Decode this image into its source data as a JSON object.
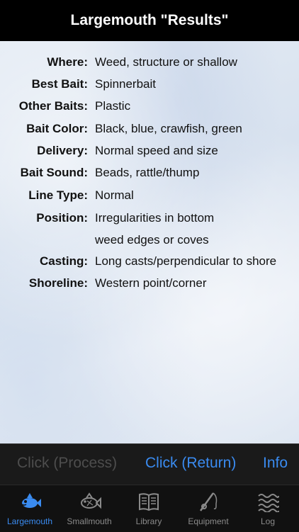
{
  "nav": {
    "title": "Largemouth \"Results\""
  },
  "results": [
    {
      "label": "Where:",
      "value": "Weed, structure or shallow"
    },
    {
      "label": "Best Bait:",
      "value": "Spinnerbait"
    },
    {
      "label": "Other Baits:",
      "value": "Plastic"
    },
    {
      "label": "Bait Color:",
      "value": "Black, blue, crawfish, green"
    },
    {
      "label": "Delivery:",
      "value": "Normal speed and size"
    },
    {
      "label": "Bait Sound:",
      "value": "Beads, rattle/thump"
    },
    {
      "label": "Line Type:",
      "value": "Normal"
    },
    {
      "label": "Position:",
      "value": "Irregularities in bottom",
      "value2": "weed edges or coves"
    },
    {
      "label": "Casting:",
      "value": "Long casts/perpendicular to shore"
    },
    {
      "label": "Shoreline:",
      "value": "Western point/corner"
    }
  ],
  "actions": {
    "process": "Click (Process)",
    "return": "Click (Return)",
    "info": "Info"
  },
  "tabs": [
    {
      "label": "Largemouth",
      "icon": "fish-icon",
      "selected": true
    },
    {
      "label": "Smallmouth",
      "icon": "fish-outline-icon",
      "selected": false
    },
    {
      "label": "Library",
      "icon": "book-icon",
      "selected": false
    },
    {
      "label": "Equipment",
      "icon": "fishing-rod-icon",
      "selected": false
    },
    {
      "label": "Log",
      "icon": "waves-icon",
      "selected": false
    }
  ],
  "colors": {
    "accent": "#3a8bf0",
    "disabled": "#4d4d4d",
    "tab_inactive": "#8a8a8a"
  }
}
